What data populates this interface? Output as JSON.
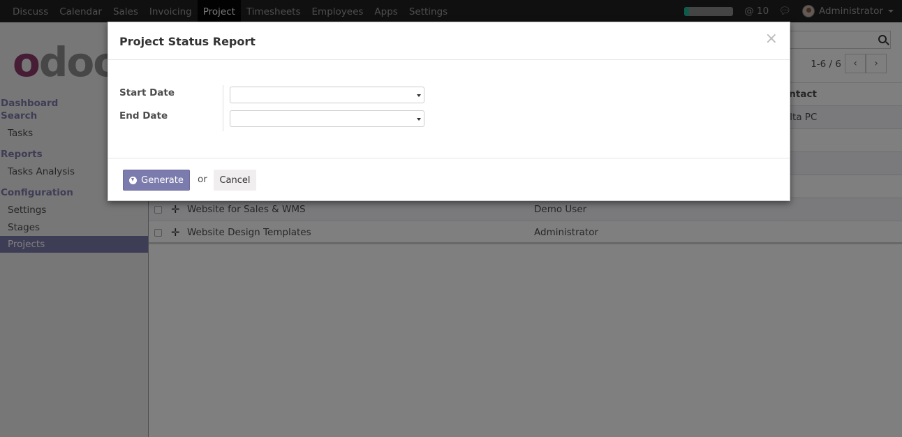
{
  "navbar": {
    "menu": [
      "Discuss",
      "Calendar",
      "Sales",
      "Invoicing",
      "Project",
      "Timesheets",
      "Employees",
      "Apps",
      "Settings"
    ],
    "active": "Project",
    "progress_fraction": 0.1,
    "messages": "@ 10",
    "user": "Administrator",
    "accent_color": "#21b799"
  },
  "sidebar": {
    "logo_text": "odoo",
    "sections": {
      "dashboard": "Dashboard",
      "search": "Search",
      "tasks": "Tasks",
      "reports": "Reports",
      "tasks_analysis": "Tasks Analysis",
      "configuration": "Configuration",
      "settings": "Settings",
      "stages": "Stages",
      "projects": "Projects"
    },
    "accent_color": "#7c7bad"
  },
  "list": {
    "pager": "1-6 / 6",
    "contact_header": "ontact",
    "rows": [
      {
        "name": "",
        "contact": "",
        "contact2": "elta PC"
      },
      {
        "name": "Website for Sales & WMS",
        "contact": "Demo User",
        "contact2": ""
      },
      {
        "name": "Website Design Templates",
        "contact": "Administrator",
        "contact2": ""
      }
    ]
  },
  "dialog": {
    "title": "Project Status Report",
    "close": "×",
    "start_label": "Start Date",
    "end_label": "End Date",
    "start_value": "",
    "end_value": "",
    "generate": "Generate",
    "or": "or",
    "cancel": "Cancel"
  }
}
